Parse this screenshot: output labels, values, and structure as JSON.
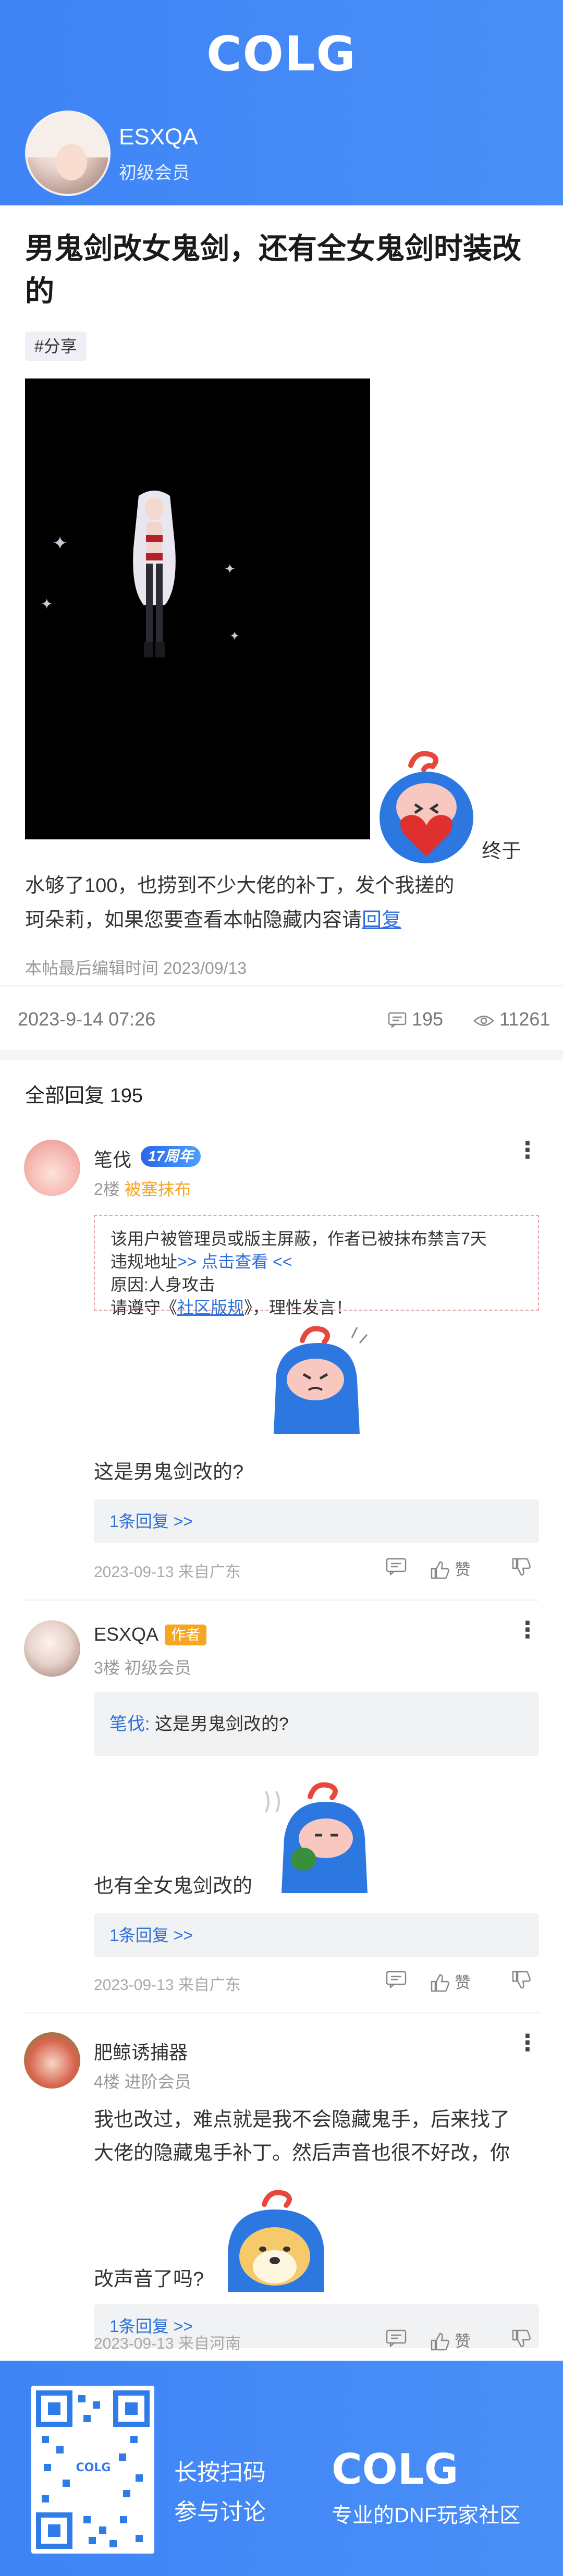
{
  "header": {
    "logo": "COLG",
    "username": "ESXQA",
    "level": "初级会员"
  },
  "post": {
    "title": "男鬼剑改女鬼剑，还有全女鬼剑时装改的",
    "tag": "#分享",
    "body_line1": "终于",
    "body_line2": "水够了100，也捞到不少大佬的补丁，发个我搓的",
    "body_line3_prefix": "珂朵莉，如果您要查看本帖隐藏内容请",
    "body_reply_link": "回复",
    "edit_time": "本帖最后编辑时间 2023/09/13",
    "date": "2023-9-14 07:26",
    "comments": "195",
    "views": "11261"
  },
  "replies_header": {
    "label": "全部回复",
    "count": "195"
  },
  "replies": [
    {
      "name": "笔伐",
      "badge": "17周年",
      "floor": "2楼",
      "level": "被塞抹布",
      "banned_line1": "该用户被管理员或版主屏蔽，作者已被抹布禁言7天",
      "banned_line2_prefix": "违规地址",
      "banned_line2_link": ">> 点击查看 <<",
      "banned_line3": "原因:人身攻击",
      "banned_line4_prefix": "请遵守《",
      "banned_line4_link": "社区版规",
      "banned_line4_suffix": "》，理性发言！",
      "text": "这是男鬼剑改的?",
      "reply_count": "1条回复 >>",
      "date": "2023-09-13 来自广东",
      "like": "赞"
    },
    {
      "name": "ESXQA",
      "badge": "作者",
      "floor": "3楼",
      "level": "初级会员",
      "quote_name": "笔伐:",
      "quote_text": " 这是男鬼剑改的?",
      "text": "也有全女鬼剑改的",
      "reply_count": "1条回复 >>",
      "date": "2023-09-13 来自广东",
      "like": "赞"
    },
    {
      "name": "肥鲸诱捕器",
      "floor": "4楼",
      "level": "进阶会员",
      "text_line1": "我也改过，难点就是我不会隐藏鬼手，后来找了",
      "text_line2": "大佬的隐藏鬼手补丁。然后声音也很不好改，你",
      "text_line3": "改声音了吗?",
      "reply_count": "1条回复 >>",
      "date": "2023-09-13 来自河南",
      "like": "赞"
    }
  ],
  "footer": {
    "qr_text": "COLG",
    "line1": "长按扫码",
    "line2": "参与讨论",
    "logo": "COLG",
    "slogan": "专业的DNF玩家社区"
  },
  "colors": {
    "brand_blue": "#3e84f5",
    "link_blue": "#2d6fd8",
    "author_badge": "#f5a623"
  }
}
